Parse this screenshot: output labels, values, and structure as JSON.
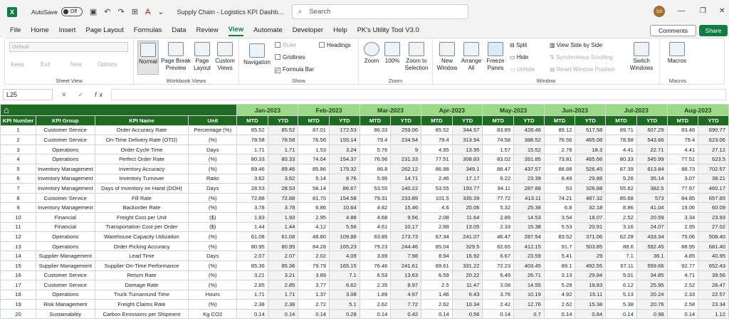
{
  "titlebar": {
    "app_icon": "X",
    "autosave_label": "AutoSave",
    "autosave_state": "Off",
    "doc_title": "Supply Chain - Logistics KPI Dashb...",
    "search_placeholder": "Search",
    "avatar": "SS"
  },
  "menu": [
    "File",
    "Home",
    "Insert",
    "Page Layout",
    "Formulas",
    "Data",
    "Review",
    "View",
    "Automate",
    "Developer",
    "Help",
    "PK's Utility Tool V3.0"
  ],
  "active_menu": "View",
  "actions": {
    "comments": "Comments",
    "share": "Share"
  },
  "ribbon": {
    "sheet_view": {
      "dropdown": "Default",
      "keep": "Keep",
      "exit": "Exit",
      "new": "New",
      "options": "Options",
      "label": "Sheet View"
    },
    "workbook_views": {
      "normal": "Normal",
      "page_break": "Page Break Preview",
      "page_layout": "Page Layout",
      "custom": "Custom Views",
      "label": "Workbook Views"
    },
    "show": {
      "navigation": "Navigation",
      "ruler": "Ruler",
      "gridlines": "Gridlines",
      "formula_bar": "Formula Bar",
      "headings": "Headings",
      "label": "Show"
    },
    "zoom": {
      "zoom": "Zoom",
      "pct": "100%",
      "zoom_sel": "Zoom to Selection",
      "label": "Zoom"
    },
    "window": {
      "new_window": "New Window",
      "arrange_all": "Arrange All",
      "freeze": "Freeze Panes",
      "split": "Split",
      "hide": "Hide",
      "unhide": "Unhide",
      "side_by_side": "View Side by Side",
      "sync": "Synchronous Scrolling",
      "reset": "Reset Window Position",
      "switch": "Switch Windows",
      "label": "Window"
    },
    "macros": {
      "macros": "Macros",
      "label": "Macros"
    }
  },
  "formula_bar": {
    "name_box": "L25",
    "fx": "fx"
  },
  "table": {
    "col_headers": [
      "KPI Number",
      "KPI Group",
      "KPI Name",
      "Unit"
    ],
    "months": [
      "Jan-2023",
      "Feb-2023",
      "Mar-2023",
      "Apr-2023",
      "May-2023",
      "Jun-2023",
      "Jul-2023",
      "Aug-2023"
    ],
    "sub": [
      "MTD",
      "YTD"
    ],
    "rows": [
      [
        "1",
        "Customer Service",
        "Order Accuracy Rate",
        "Percentage (%)",
        "85.52",
        "85.52",
        "87.01",
        "172.53",
        "86.33",
        "259.06",
        "85.52",
        "344.57",
        "83.89",
        "428.46",
        "89.12",
        "517.58",
        "89.71",
        "607.29",
        "83.48",
        "690.77"
      ],
      [
        "2",
        "Customer Service",
        "On-Time Delivery Rate (OTD)",
        "(%)",
        "78.58",
        "78.58",
        "76.56",
        "155.14",
        "79.4",
        "234.54",
        "79.4",
        "313.94",
        "74.58",
        "388.52",
        "76.56",
        "465.08",
        "78.58",
        "543.66",
        "79.4",
        "623.06"
      ],
      [
        "3",
        "Operations",
        "Order Cycle Time",
        "Days",
        "1.71",
        "1.71",
        "1.53",
        "3.24",
        "5.76",
        "9",
        "4.95",
        "13.95",
        "1.57",
        "15.52",
        "2.78",
        "18.3",
        "4.41",
        "22.71",
        "4.41",
        "27.12"
      ],
      [
        "4",
        "Operations",
        "Perfect Order Rate",
        "(%)",
        "80.33",
        "80.33",
        "74.04",
        "154.37",
        "76.96",
        "231.33",
        "77.51",
        "308.83",
        "83.02",
        "391.85",
        "73.81",
        "465.66",
        "80.33",
        "545.99",
        "77.51",
        "623.5"
      ],
      [
        "5",
        "Inventory Management",
        "Inventory Accuracy",
        "(%)",
        "89.46",
        "89.46",
        "85.86",
        "175.32",
        "86.8",
        "262.12",
        "86.98",
        "349.1",
        "88.47",
        "437.57",
        "88.88",
        "526.45",
        "87.39",
        "613.84",
        "88.73",
        "702.57"
      ],
      [
        "6",
        "Inventory Management",
        "Inventory Turnover",
        "Ratio",
        "3.62",
        "3.62",
        "5.14",
        "8.76",
        "5.95",
        "14.71",
        "2.46",
        "17.17",
        "6.22",
        "23.39",
        "6.49",
        "29.88",
        "5.26",
        "35.14",
        "3.07",
        "38.21"
      ],
      [
        "7",
        "Inventory Management",
        "Days of Inventory on Hand (DOH)",
        "Days",
        "28.53",
        "28.53",
        "58.14",
        "86.67",
        "53.55",
        "140.22",
        "53.55",
        "193.77",
        "94.11",
        "287.88",
        "63",
        "326.88",
        "55.62",
        "382.5",
        "77.67",
        "460.17"
      ],
      [
        "8",
        "Customer Service",
        "Fill Rate",
        "(%)",
        "72.88",
        "72.88",
        "81.70",
        "154.58",
        "79.31",
        "233.89",
        "101.5",
        "335.39",
        "77.72",
        "413.11",
        "74.21",
        "487.32",
        "85.68",
        "573",
        "84.85",
        "657.85"
      ],
      [
        "9",
        "Inventory Management",
        "Backorder Rate",
        "(%)",
        "3.78",
        "3.78",
        "6.86",
        "10.64",
        "4.82",
        "15.46",
        "4.6",
        "20.06",
        "5.32",
        "25.38",
        "6.8",
        "32.18",
        "8.86",
        "41.04",
        "19.06",
        "60.09"
      ],
      [
        "10",
        "Financial",
        "Freight Cost per Unit",
        "($)",
        "1.93",
        "1.93",
        "2.95",
        "4.88",
        "4.68",
        "9.56",
        "2.08",
        "11.64",
        "2.89",
        "14.53",
        "3.54",
        "18.07",
        "2.52",
        "20.59",
        "3.34",
        "23.93"
      ],
      [
        "11",
        "Financial",
        "Transportation Cost per Order",
        "($)",
        "1.44",
        "1.44",
        "4.12",
        "5.56",
        "4.61",
        "10.17",
        "2.88",
        "13.05",
        "2.33",
        "15.38",
        "5.53",
        "20.91",
        "3.16",
        "24.07",
        "2.95",
        "27.02"
      ],
      [
        "12",
        "Operations",
        "Warehouse Capacity Utilization",
        "(%)",
        "61.08",
        "61.08",
        "48.80",
        "109.88",
        "63.85",
        "173.73",
        "67.34",
        "241.07",
        "46.47",
        "287.54",
        "83.52",
        "371.06",
        "62.28",
        "433.34",
        "75.06",
        "508.40"
      ],
      [
        "13",
        "Operations",
        "Order Picking Accuracy",
        "(%)",
        "80.95",
        "80.95",
        "84.28",
        "165.23",
        "79.23",
        "244.46",
        "85.04",
        "329.5",
        "82.65",
        "412.15",
        "91.7",
        "503.85",
        "88.6",
        "592.45",
        "88.95",
        "681.40"
      ],
      [
        "14",
        "Supplier Management",
        "Lead Time",
        "Days",
        "2.07",
        "2.07",
        "2.02",
        "4.09",
        "3.89",
        "7.98",
        "8.94",
        "16.92",
        "6.67",
        "23.59",
        "5.41",
        "29",
        "7.1",
        "36.1",
        "4.85",
        "40.95"
      ],
      [
        "15",
        "Supplier Management",
        "Supplier On-Time Performance",
        "(%)",
        "85.36",
        "85.36",
        "79.79",
        "165.15",
        "76.46",
        "241.61",
        "89.61",
        "331.22",
        "72.23",
        "403.45",
        "89.1",
        "492.55",
        "67.11",
        "559.66",
        "92.77",
        "652.43"
      ],
      [
        "16",
        "Customer Service",
        "Return Rate",
        "(%)",
        "3.21",
        "3.21",
        "3.89",
        "7.1",
        "6.53",
        "13.63",
        "6.59",
        "20.22",
        "6.49",
        "26.71",
        "3.13",
        "29.84",
        "5.01",
        "34.85",
        "4.71",
        "39.56"
      ],
      [
        "17",
        "Customer Service",
        "Damage Rate",
        "(%)",
        "2.85",
        "2.85",
        "3.77",
        "6.62",
        "2.35",
        "8.97",
        "2.5",
        "11.47",
        "3.08",
        "14.55",
        "5.28",
        "19.83",
        "6.12",
        "25.95",
        "2.52",
        "28.47"
      ],
      [
        "18",
        "Operations",
        "Truck Turnaround Time",
        "Hours",
        "1.71",
        "1.71",
        "1.37",
        "3.08",
        "1.89",
        "4.97",
        "1.46",
        "6.43",
        "3.76",
        "10.19",
        "4.92",
        "15.11",
        "5.13",
        "20.24",
        "2.33",
        "22.57"
      ],
      [
        "19",
        "Risk Management",
        "Freight Claims Rate",
        "(%)",
        "2.38",
        "2.38",
        "2.72",
        "5.1",
        "2.62",
        "7.72",
        "2.62",
        "10.34",
        "2.42",
        "12.76",
        "2.62",
        "15.38",
        "5.38",
        "20.76",
        "2.58",
        "23.34"
      ],
      [
        "20",
        "Sustainability",
        "Carbon Emissions per Shipment",
        "Kg CO2",
        "0.14",
        "0.14",
        "0.14",
        "0.28",
        "0.14",
        "0.42",
        "0.14",
        "0.56",
        "0.14",
        "0.7",
        "0.14",
        "0.84",
        "0.14",
        "0.98",
        "0.14",
        "1.12"
      ]
    ]
  },
  "colors": {
    "excel_green": "#107c41",
    "header_dark": "#1f6b24",
    "header_light": "#9bd986"
  }
}
